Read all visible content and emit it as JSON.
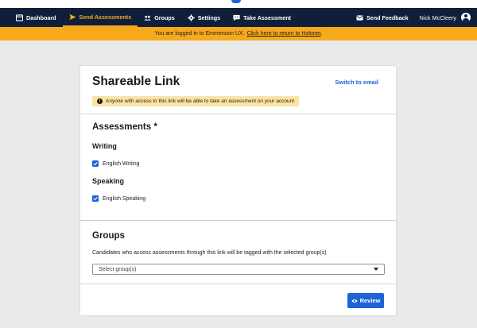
{
  "nav": {
    "items": [
      {
        "label": "Dashboard",
        "icon": "dashboard-icon"
      },
      {
        "label": "Send Assessments",
        "icon": "send-icon",
        "active": true
      },
      {
        "label": "Groups",
        "icon": "groups-icon"
      },
      {
        "label": "Settings",
        "icon": "gear-icon"
      },
      {
        "label": "Take Assessment",
        "icon": "chat-icon"
      }
    ],
    "feedback_label": "Send Feedback",
    "user_name": "Nick McCleery"
  },
  "banner": {
    "text": "You are logged in to Emmersion UX.",
    "link": "Click here to return to Holonet",
    "suffix": "."
  },
  "card": {
    "title": "Shareable Link",
    "switch_label": "Switch to email",
    "warning": "Anyone with access to this link will be able to take an assessment on your account",
    "assessments_heading": "Assessments *",
    "writing_heading": "Writing",
    "writing_option": "English Writing",
    "speaking_heading": "Speaking",
    "speaking_option": "English Speaking",
    "groups_heading": "Groups",
    "groups_description": "Candidates who access assessments through this link will be tagged with the selected group(s)",
    "groups_placeholder": "Select group(s)",
    "review_label": "Review"
  },
  "colors": {
    "nav_bg": "#0f1f3a",
    "accent": "#f5a623",
    "banner_bg": "#f6a91b",
    "primary": "#1c63d6",
    "warning_bg": "#fbe3a3"
  }
}
